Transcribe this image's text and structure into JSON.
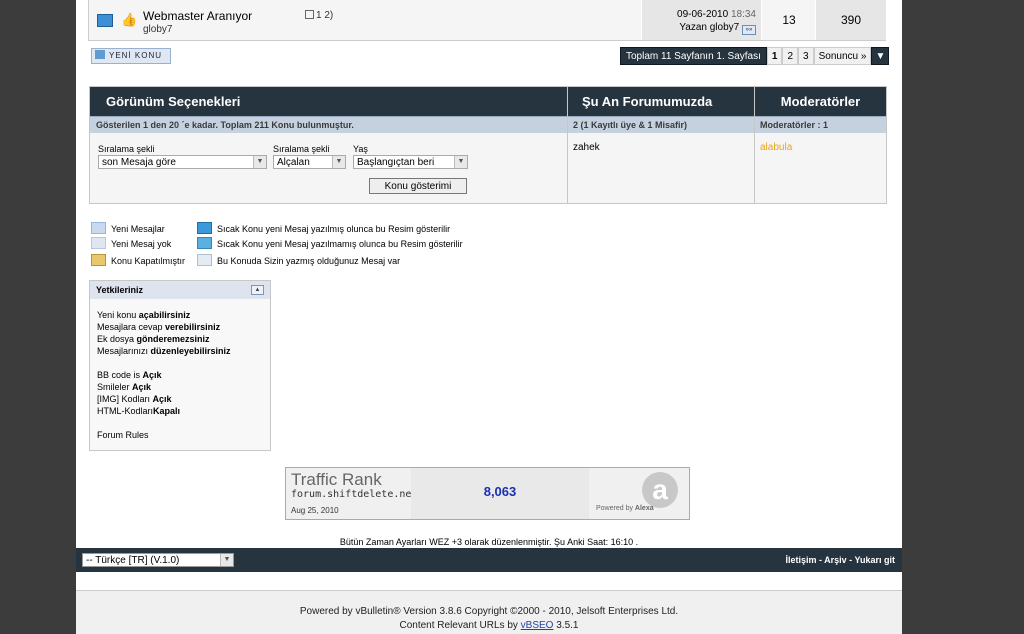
{
  "thread": {
    "title": "Webmaster Aranıyor",
    "pages": "1 2)",
    "author": "globy7",
    "last_post_date": "09-06-2010",
    "last_post_time": "18:34",
    "last_post_by": "Yazan globy7",
    "replies": "13",
    "views": "390"
  },
  "new_thread_label": "YENİ KONU",
  "pager": {
    "label": "Toplam 11 Sayfanın 1. Sayfası",
    "pages": [
      "1",
      "2",
      "3"
    ],
    "last": "Sonuncu »"
  },
  "options": {
    "header_display": "Görünüm Seçenekleri",
    "header_online": "Şu An Forumumuzda",
    "header_mods": "Moderatörler",
    "summary": "Gösterilen 1 den 20 ´e kadar. Toplam 211 Konu bulunmuştur.",
    "online_count": "2 (1 Kayıtlı üye & 1 Misafir)",
    "mods_count": "Moderatörler : 1",
    "sort_label": "Sıralama şekli",
    "sort_value": "son Mesaja göre",
    "order_label": "Sıralama şekli",
    "order_value": "Alçalan",
    "age_label": "Yaş",
    "age_value": "Başlangıçtan beri",
    "show_button": "Konu gösterimi",
    "online_user": "zahek",
    "moderator": "alabula"
  },
  "legend": [
    "Yeni Mesajlar",
    "Yeni Mesaj yok",
    "Konu Kapatılmıştır",
    "Sıcak Konu yeni Mesaj yazılmış olunca bu Resim gösterilir",
    "Sıcak Konu yeni Mesaj yazılmamış olunca bu Resim gösterilir",
    "Bu Konuda Sizin yazmış olduğunuz Mesaj var"
  ],
  "permissions": {
    "title": "Yetkileriniz",
    "lines": [
      {
        "pre": "Yeni konu ",
        "bold": "açabilirsiniz"
      },
      {
        "pre": "Mesajlara cevap ",
        "bold": "verebilirsiniz"
      },
      {
        "pre": "Ek dosya ",
        "bold": "gönderemezsiniz"
      },
      {
        "pre": "Mesajlarınızı ",
        "bold": "düzenleyebilirsiniz"
      },
      {
        "pre": "BB code is ",
        "bold": "Açık"
      },
      {
        "pre": "Smileler ",
        "bold": "Açık"
      },
      {
        "pre": "[IMG] Kodları ",
        "bold": "Açık"
      },
      {
        "pre": "HTML-Kodları",
        "bold": "Kapalı"
      },
      {
        "pre": "Forum Rules",
        "bold": ""
      }
    ]
  },
  "alexa": {
    "heading": "Traffic Rank",
    "site": "forum.shiftdelete.net",
    "rank": "8,063",
    "date": "Aug 25, 2010",
    "powered": "Powered by",
    "brand": "Alexa"
  },
  "timezone_text": "Bütün Zaman Ayarları WEZ +3 olarak düzenlenmiştir. Şu Anki Saat: 16:10 .",
  "language": "-- Türkçe [TR] (V.1.0)",
  "footer_links": [
    "İletişim",
    "Arşiv",
    "Yukarı git"
  ],
  "powered": {
    "line1": "Powered by vBulletin® Version 3.8.6 Copyright ©2000 - 2010, Jelsoft Enterprises Ltd.",
    "line2_pre": "Content Relevant URLs by ",
    "line2_link": "vBSEO",
    "line2_post": " 3.5.1"
  },
  "colors": {
    "header_bg": "#26343f",
    "subheader_bg": "#c6d1e0",
    "moderator": "#e8a317",
    "rank": "#1a2fb5"
  }
}
